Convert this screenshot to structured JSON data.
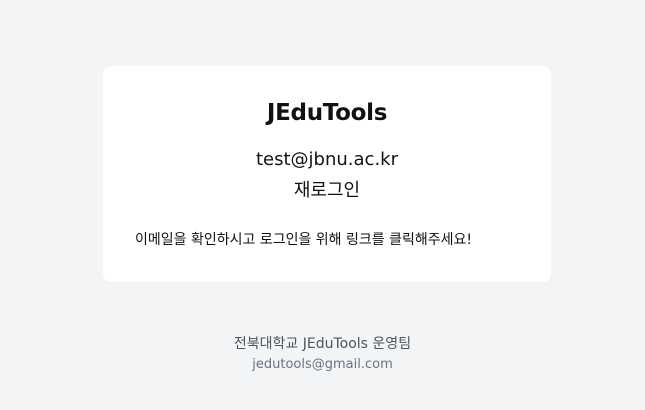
{
  "card": {
    "brand": "JEduTools",
    "email": "test@jbnu.ac.kr",
    "relogin_label": "재로그인",
    "message": "이메일을 확인하시고 로그인을 위해 링크를 클릭해주세요!"
  },
  "footer": {
    "team": "전북대학교 JEduTools 운영팀",
    "contact_email": "jedutools@gmail.com"
  },
  "colors": {
    "background": "#f3f4f6",
    "card": "#ffffff",
    "text": "#111111",
    "footer_text": "#4b5563",
    "footer_muted": "#6b7280"
  }
}
